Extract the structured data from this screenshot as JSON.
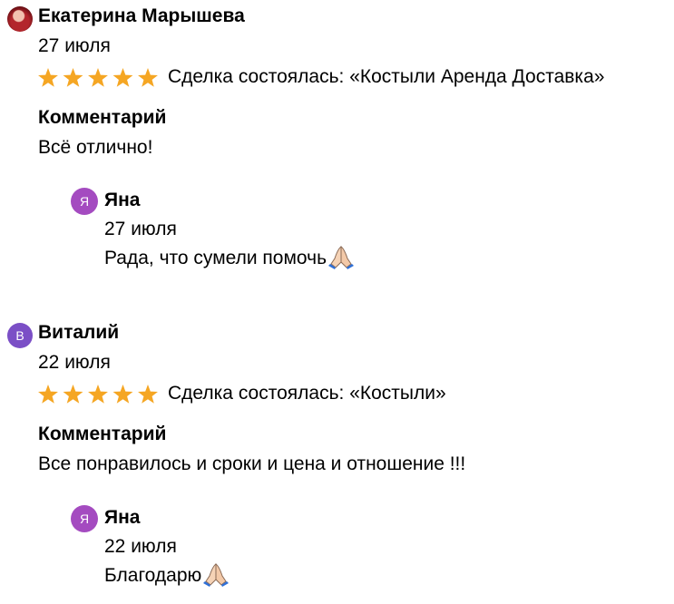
{
  "colors": {
    "star": "#f5a623",
    "avatar_purple_reply": "#a44bc0",
    "avatar_purple_author": "#7b4fc6"
  },
  "reviews": [
    {
      "author": "Екатерина Марышева",
      "avatar": "photo",
      "date": "27 июля",
      "rating": 5,
      "deal": "Сделка состоялась: «Костыли Аренда Доставка»",
      "comment_heading": "Комментарий",
      "comment": "Всё отлично!",
      "reply": {
        "author_initial": "Я",
        "author": "Яна",
        "date": "27 июля",
        "text": "Рада, что сумели помочь",
        "icon": "praying-hands-icon"
      }
    },
    {
      "author": "Виталий",
      "avatar_initial": "В",
      "date": "22 июля",
      "rating": 5,
      "deal": "Сделка состоялась: «Костыли»",
      "comment_heading": "Комментарий",
      "comment": "Все понравилось и сроки и цена и отношение !!!",
      "reply": {
        "author_initial": "Я",
        "author": "Яна",
        "date": "22 июля",
        "text": "Благодарю",
        "icon": "praying-hands-icon"
      }
    }
  ]
}
